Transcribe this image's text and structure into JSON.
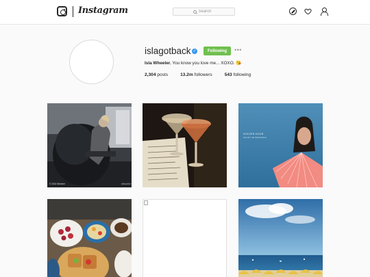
{
  "header": {
    "wordmark": "Instagram",
    "search": {
      "placeholder": "Search"
    }
  },
  "profile": {
    "username": "islagotback",
    "follow_button": "Following",
    "bio_name": "Isla Wheeler.",
    "bio_text": "You know you love me... XOXO.",
    "bio_emoji": "😘",
    "stats": {
      "posts_count": "2,304",
      "posts_label": "posts",
      "followers_count": "13.2m",
      "followers_label": "followers",
      "following_count": "543",
      "following_label": "following"
    }
  },
  "posts": [
    {
      "caption": "© 2015 Wheeler",
      "signature": "wheeler"
    },
    {
      "caption": ""
    },
    {
      "caption": "GOLDEN HOUR",
      "subcaption": "KACEY MUSGRAVES"
    },
    {
      "caption": ""
    },
    {
      "caption": ""
    },
    {
      "caption": ""
    }
  ],
  "colors": {
    "verified": "#3897f0",
    "following_button": "#70c050",
    "background": "#fafafa"
  }
}
